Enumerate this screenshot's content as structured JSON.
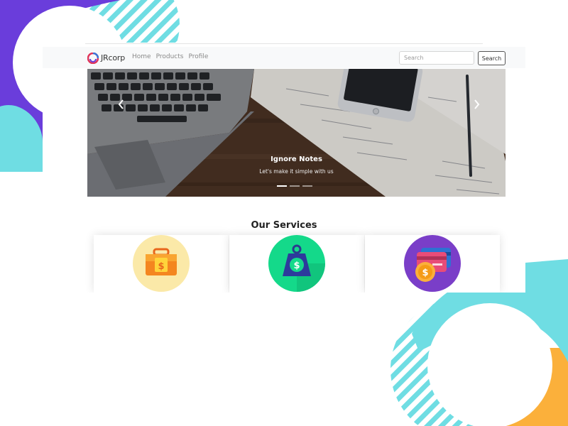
{
  "navbar": {
    "brand": "JRcorp",
    "links": [
      "Home",
      "Products",
      "Profile"
    ],
    "search_placeholder": "Search",
    "search_button": "Search"
  },
  "carousel": {
    "title": "Ignore Notes",
    "subtitle": "Let's make it simple with us",
    "slide_count": 3,
    "active_index": 0
  },
  "services": {
    "heading": "Our Services",
    "items": [
      {
        "icon": "briefcase-dollar-icon"
      },
      {
        "icon": "money-weight-icon"
      },
      {
        "icon": "credit-card-coin-icon"
      }
    ]
  },
  "colors": {
    "purple": "#6a3ddb",
    "teal": "#6fdde3",
    "orange": "#fbb03b",
    "navbar_bg": "#f8f9fa"
  }
}
